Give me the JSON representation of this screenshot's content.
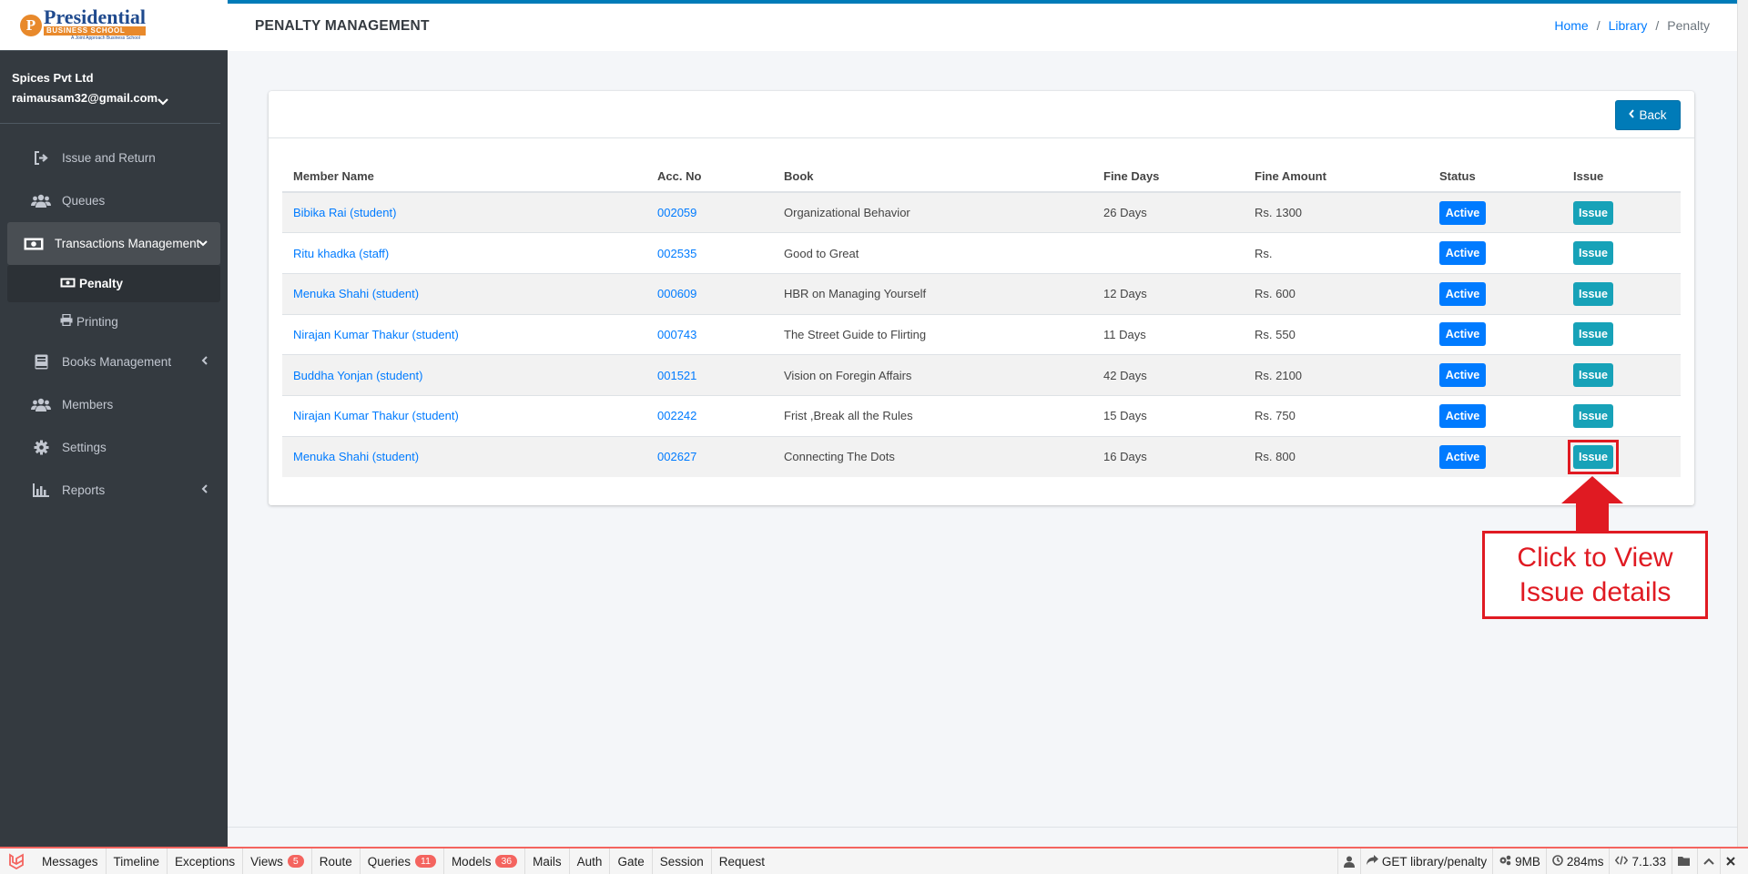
{
  "brand": {
    "logo_letter": "P",
    "logo_main": "Presidential",
    "logo_sub": "BUSINESS SCHOOL",
    "logo_tag": "A Joint Approach Business School"
  },
  "user": {
    "company": "Spices Pvt Ltd",
    "email": "raimausam32@gmail.com",
    "caret": "⌄"
  },
  "sidebar": {
    "items": [
      {
        "label": "Issue and Return",
        "icon": "sign-out-icon"
      },
      {
        "label": "Queues",
        "icon": "users-icon"
      },
      {
        "label": "Transactions Management",
        "icon": "money-bill-icon"
      },
      {
        "label": "Penalty",
        "icon": "money-bill-icon"
      },
      {
        "label": "Printing",
        "icon": "print-icon"
      },
      {
        "label": "Books Management",
        "icon": "book-icon"
      },
      {
        "label": "Members",
        "icon": "users-icon"
      },
      {
        "label": "Settings",
        "icon": "cog-icon"
      },
      {
        "label": "Reports",
        "icon": "bar-chart-icon"
      }
    ]
  },
  "header": {
    "title": "PENALTY MANAGEMENT",
    "breadcrumb": [
      "Home",
      "Library",
      "Penalty"
    ],
    "separator": "/"
  },
  "card": {
    "back_label": "Back"
  },
  "table": {
    "columns": [
      "Member Name",
      "Acc. No",
      "Book",
      "Fine Days",
      "Fine Amount",
      "Status",
      "Issue"
    ],
    "rows": [
      {
        "member": "Bibika Rai (student)",
        "acc": "002059",
        "book": "Organizational Behavior",
        "days": "26 Days",
        "amount": "Rs. 1300",
        "status": "Active",
        "issue": "Issue"
      },
      {
        "member": "Ritu khadka (staff)",
        "acc": "002535",
        "book": "Good to Great",
        "days": "",
        "amount": "Rs.",
        "status": "Active",
        "issue": "Issue"
      },
      {
        "member": "Menuka Shahi (student)",
        "acc": "000609",
        "book": "HBR on Managing Yourself",
        "days": "12 Days",
        "amount": "Rs. 600",
        "status": "Active",
        "issue": "Issue"
      },
      {
        "member": "Nirajan Kumar Thakur (student)",
        "acc": "000743",
        "book": "The Street Guide to Flirting",
        "days": "11 Days",
        "amount": "Rs. 550",
        "status": "Active",
        "issue": "Issue"
      },
      {
        "member": "Buddha Yonjan (student)",
        "acc": "001521",
        "book": "Vision on Foregin Affairs",
        "days": "42 Days",
        "amount": "Rs. 2100",
        "status": "Active",
        "issue": "Issue"
      },
      {
        "member": "Nirajan Kumar Thakur (student)",
        "acc": "002242",
        "book": "Frist ,Break all the Rules",
        "days": "15 Days",
        "amount": "Rs. 750",
        "status": "Active",
        "issue": "Issue"
      },
      {
        "member": "Menuka Shahi (student)",
        "acc": "002627",
        "book": "Connecting The Dots",
        "days": "16 Days",
        "amount": "Rs. 800",
        "status": "Active",
        "issue": "Issue"
      }
    ]
  },
  "annotation": {
    "text": "Click to View Issue details",
    "color": "#e01a22"
  },
  "debugbar": {
    "tabs": [
      {
        "label": "Messages",
        "count": ""
      },
      {
        "label": "Timeline",
        "count": ""
      },
      {
        "label": "Exceptions",
        "count": ""
      },
      {
        "label": "Views",
        "count": "5"
      },
      {
        "label": "Route",
        "count": ""
      },
      {
        "label": "Queries",
        "count": "11"
      },
      {
        "label": "Models",
        "count": "36"
      },
      {
        "label": "Mails",
        "count": ""
      },
      {
        "label": "Auth",
        "count": ""
      },
      {
        "label": "Gate",
        "count": ""
      },
      {
        "label": "Session",
        "count": ""
      },
      {
        "label": "Request",
        "count": ""
      }
    ],
    "request": "GET library/penalty",
    "memory": "9MB",
    "time": "284ms",
    "php_version": "7.1.33"
  },
  "colors": {
    "sidebar_bg": "#343a40",
    "primary": "#007bff",
    "accent_top": "#007bb8",
    "issue_btn": "#17a2b8"
  }
}
